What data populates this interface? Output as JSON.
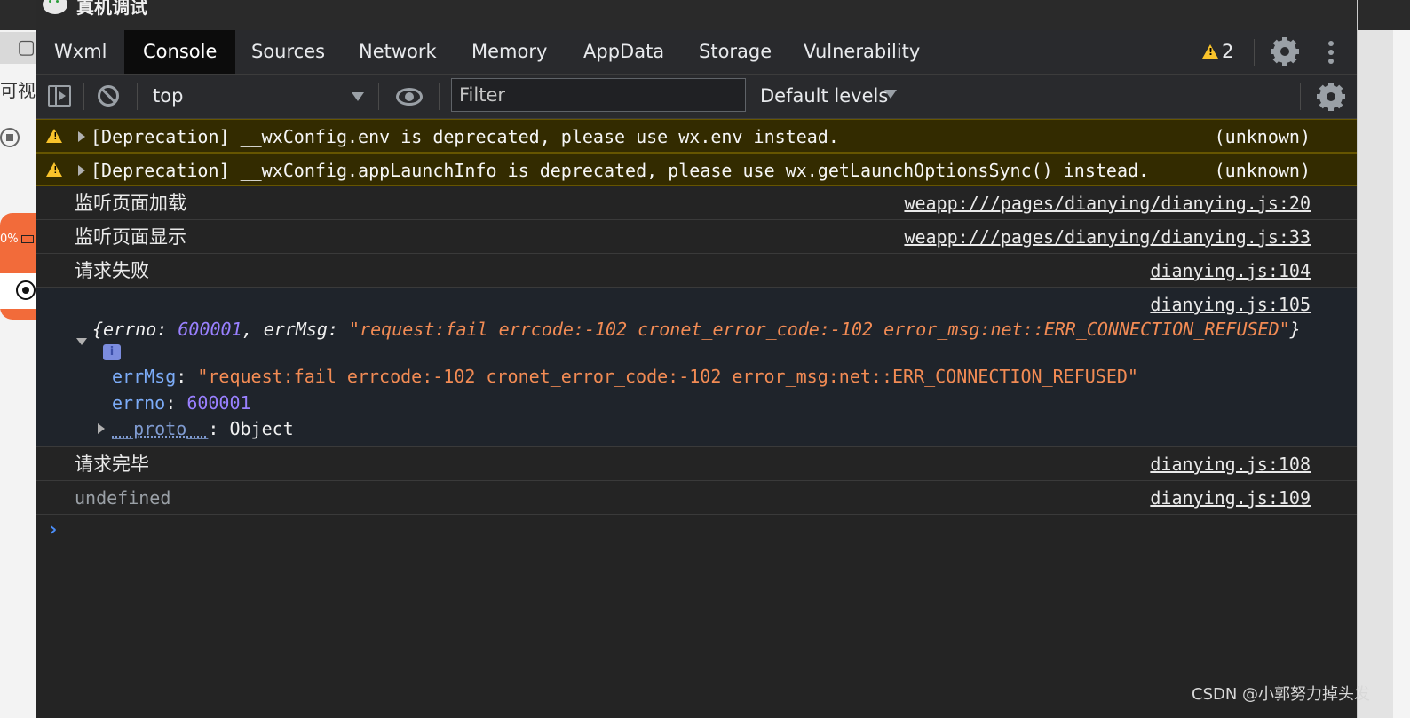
{
  "window": {
    "title": "真机调试"
  },
  "background_app": {
    "label": "可视",
    "status_text": "0%"
  },
  "tabs": [
    {
      "label": "Wxml"
    },
    {
      "label": "Console"
    },
    {
      "label": "Sources"
    },
    {
      "label": "Network"
    },
    {
      "label": "Memory"
    },
    {
      "label": "AppData"
    },
    {
      "label": "Storage"
    },
    {
      "label": "Vulnerability"
    }
  ],
  "active_tab": "Console",
  "warnings_badge": {
    "count": "2"
  },
  "toolbar": {
    "context": "top",
    "filter_placeholder": "Filter",
    "levels": "Default levels"
  },
  "console": {
    "messages": [
      {
        "level": "warning",
        "text": "[Deprecation] __wxConfig.env is deprecated, please use wx.env instead.",
        "source": "(unknown)"
      },
      {
        "level": "warning",
        "text": "[Deprecation] __wxConfig.appLaunchInfo is deprecated, please use wx.getLaunchOptionsSync() instead.",
        "source": "(unknown)"
      },
      {
        "level": "log",
        "text": "监听页面加载",
        "source": "weapp:///pages/dianying/dianying.js:20"
      },
      {
        "level": "log",
        "text": "监听页面显示",
        "source": "weapp:///pages/dianying/dianying.js:33"
      },
      {
        "level": "log",
        "text": "请求失败",
        "source": "dianying.js:104"
      },
      {
        "level": "log",
        "text": "请求完毕",
        "source": "dianying.js:108"
      },
      {
        "level": "log",
        "text": "undefined",
        "source": "dianying.js:109"
      }
    ],
    "object_log": {
      "source": "dianying.js:105",
      "summary": {
        "open": "{",
        "k1": "errno",
        "v1": "600001",
        "k2": "errMsg",
        "v2": "\"request:fail errcode:-102 cronet_error_code:-102 error_msg:net::ERR_CONNECTION_REFUSED\"",
        "close": "}"
      },
      "info_badge": "i",
      "properties": [
        {
          "key": "errMsg",
          "value": "\"request:fail errcode:-102 cronet_error_code:-102 error_msg:net::ERR_CONNECTION_REFUSED\""
        },
        {
          "key": "errno",
          "value": "600001"
        },
        {
          "key": "__proto__",
          "value": "Object"
        }
      ]
    },
    "prompt": "›"
  },
  "watermark": "CSDN @小郭努力掉头发",
  "colors": {
    "accent_prompt": "#4a8df8",
    "warning_bg": "#332b00",
    "warning_icon": "#f9c32b",
    "number": "#9980ff",
    "string": "#f28b54",
    "key": "#7cacf8"
  }
}
